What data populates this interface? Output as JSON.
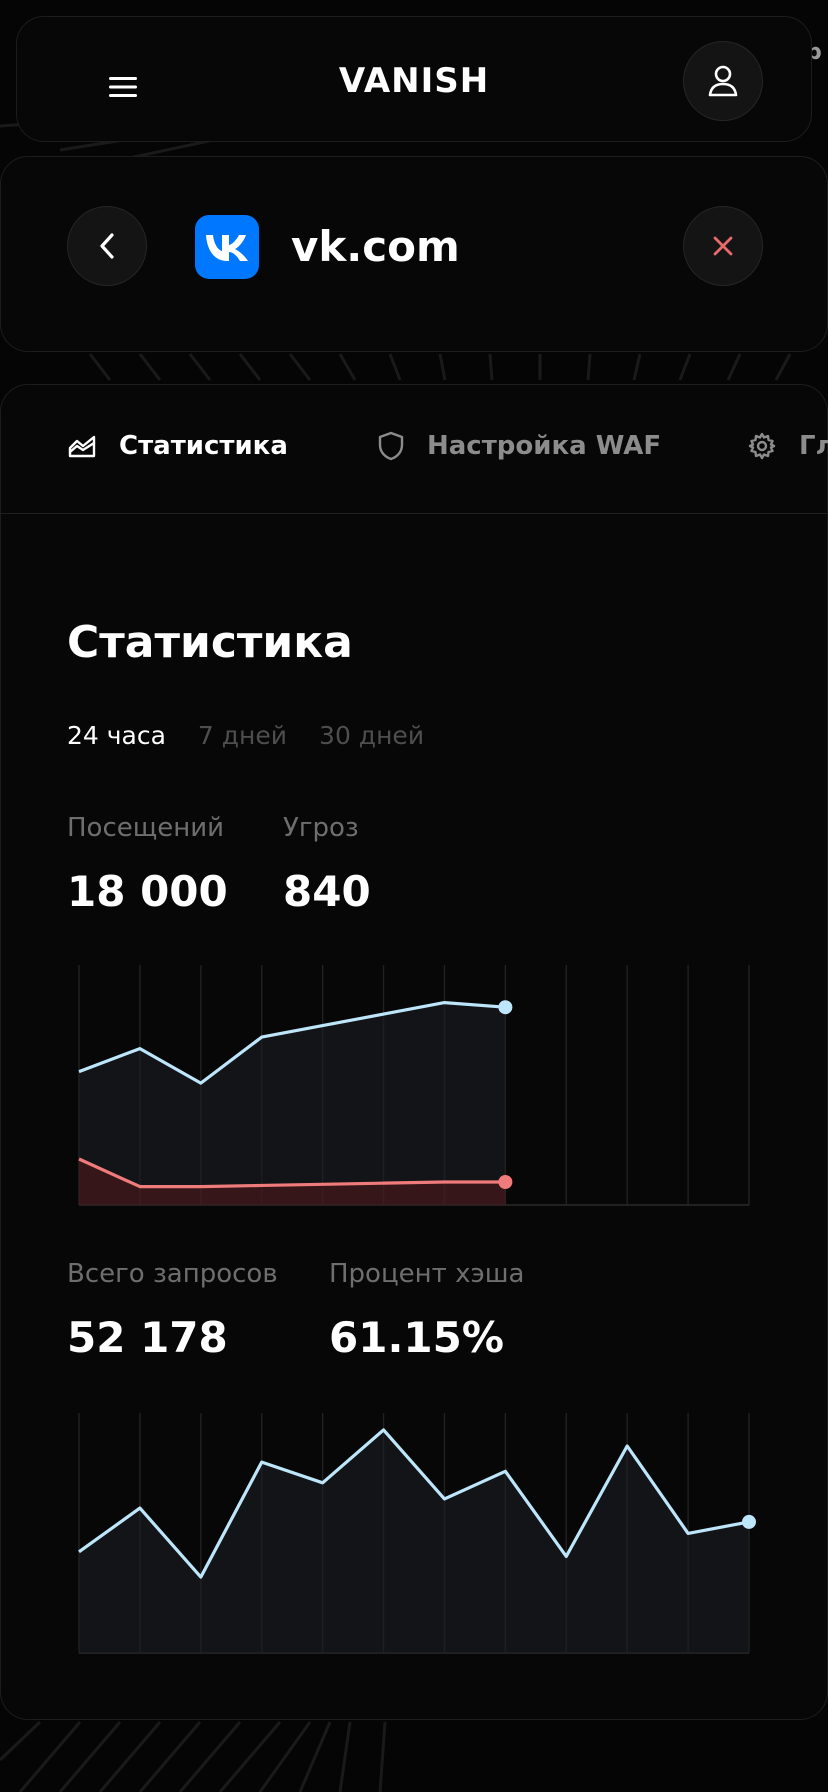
{
  "header": {
    "logo": "VANISH",
    "peek_text": "р"
  },
  "site": {
    "name": "vk.com",
    "icon": "vk-logo-icon"
  },
  "tabs": [
    {
      "label": "Статистика",
      "icon": "chart-area-icon",
      "active": true
    },
    {
      "label": "Настройка WAF",
      "icon": "shield-icon",
      "active": false
    },
    {
      "label": "Гл",
      "icon": "gear-icon",
      "active": false
    }
  ],
  "stats": {
    "title": "Статистика",
    "periods": [
      {
        "label": "24 часа",
        "active": true
      },
      {
        "label": "7 дней",
        "active": false
      },
      {
        "label": "30 дней",
        "active": false
      }
    ],
    "visits": {
      "label": "Посещений",
      "value": "18 000"
    },
    "threats": {
      "label": "Угроз",
      "value": "840"
    },
    "requests": {
      "label": "Всего запросов",
      "value": "52 178"
    },
    "cache": {
      "label": "Процент хэша",
      "value": "61.15%"
    }
  },
  "colors": {
    "accent_blue": "#bde6fb",
    "accent_red": "#f07b7b",
    "vk_blue": "#0077ff",
    "close_red": "#e86a6a"
  },
  "chart_data": [
    {
      "type": "area",
      "x": [
        0,
        1,
        2,
        3,
        4,
        5,
        6,
        7,
        8,
        9,
        10,
        11
      ],
      "ylim": [
        0,
        100
      ],
      "grid": true,
      "series": [
        {
          "values": [
            58,
            68,
            53,
            73,
            78,
            83,
            88,
            86
          ]
        },
        {
          "values": [
            20,
            8,
            8,
            8.5,
            9,
            9.5,
            10,
            10
          ]
        }
      ]
    },
    {
      "type": "area",
      "x": [
        0,
        1,
        2,
        3,
        4,
        5,
        6,
        7,
        8,
        9,
        10,
        11
      ],
      "ylim": [
        0,
        100
      ],
      "grid": true,
      "series": [
        {
          "values": [
            44,
            63,
            33,
            83,
            74,
            97,
            67,
            79,
            42,
            90,
            52,
            57
          ]
        }
      ]
    }
  ]
}
